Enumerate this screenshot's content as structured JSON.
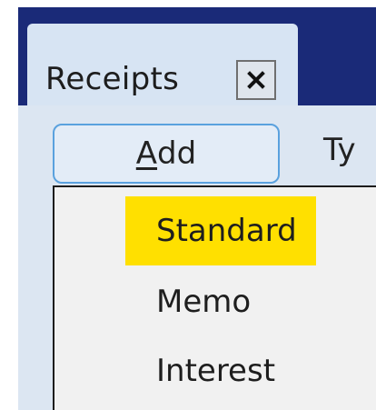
{
  "tab": {
    "title": "Receipts",
    "close_icon": "close-icon"
  },
  "toolbar": {
    "add_mnemonic": "A",
    "add_rest": "dd",
    "type_label": "Ty"
  },
  "dropdown": {
    "items": [
      {
        "label": "Standard",
        "highlighted": true
      },
      {
        "label": "Memo",
        "highlighted": false
      },
      {
        "label": "Interest",
        "highlighted": false
      }
    ]
  },
  "colors": {
    "title_bar": "#1a2a78",
    "panel": "#dce6f2",
    "highlight": "#ffe000",
    "button_border": "#5aa1de"
  }
}
